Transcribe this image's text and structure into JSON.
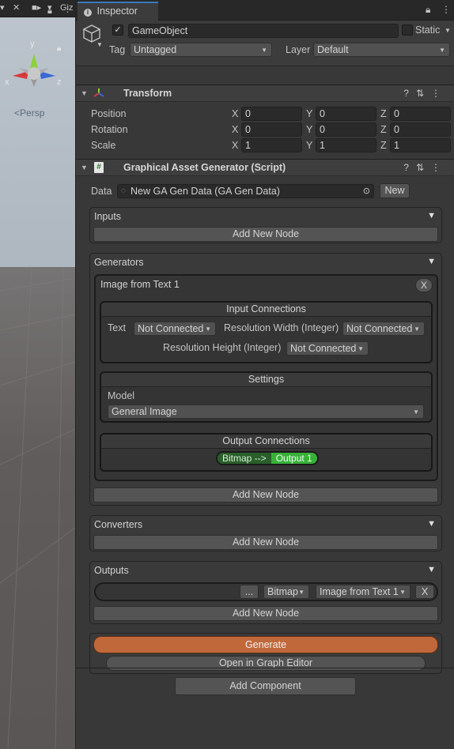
{
  "scene": {
    "toolbar": {
      "more": "⋮",
      "gizmos_label": "Giz"
    },
    "gizmo_axes": {
      "y": "y",
      "x": "x",
      "z": "z"
    },
    "persp_label": "Persp"
  },
  "inspector": {
    "tab_label": "Inspector",
    "game_object": {
      "active_check": "✓",
      "name": "GameObject",
      "static_label": "Static",
      "tag_label": "Tag",
      "tag_value": "Untagged",
      "layer_label": "Layer",
      "layer_value": "Default"
    },
    "transform": {
      "title": "Transform",
      "rows": [
        {
          "label": "Position",
          "x": "0",
          "y": "0",
          "z": "0"
        },
        {
          "label": "Rotation",
          "x": "0",
          "y": "0",
          "z": "0"
        },
        {
          "label": "Scale",
          "x": "1",
          "y": "1",
          "z": "1"
        }
      ],
      "axis_x": "X",
      "axis_y": "Y",
      "axis_z": "Z"
    },
    "script": {
      "title": "Graphical Asset Generator (Script)",
      "data_label": "Data",
      "data_value": "New GA Gen Data (GA Gen Data)",
      "new_button": "New",
      "inputs": {
        "title": "Inputs",
        "add_button": "Add New Node"
      },
      "generators": {
        "title": "Generators",
        "node": {
          "title": "Image from Text 1",
          "close": "X",
          "input_connections": {
            "title": "Input Connections",
            "text_label": "Text",
            "text_value": "Not Connected",
            "res_width_label": "Resolution Width (Integer)",
            "res_width_value": "Not Connected",
            "res_height_label": "Resolution Height (Integer)",
            "res_height_value": "Not Connected"
          },
          "settings": {
            "title": "Settings",
            "model_label": "Model",
            "model_value": "General Image"
          },
          "output_connections": {
            "title": "Output Connections",
            "pill_left": "Bitmap -->",
            "pill_right": "Output 1"
          }
        },
        "add_button": "Add New Node"
      },
      "converters": {
        "title": "Converters",
        "add_button": "Add New Node"
      },
      "outputs": {
        "title": "Outputs",
        "row": {
          "browse": "...",
          "type": "Bitmap",
          "source": "Image from Text 1",
          "close": "X"
        },
        "add_button": "Add New Node"
      },
      "generate_button": "Generate",
      "graph_editor_button": "Open in Graph Editor"
    },
    "add_component_button": "Add Component"
  },
  "colors": {
    "accent_tab": "#3a79bb",
    "generate": "#c0683a",
    "pill_green": "#38b038"
  }
}
